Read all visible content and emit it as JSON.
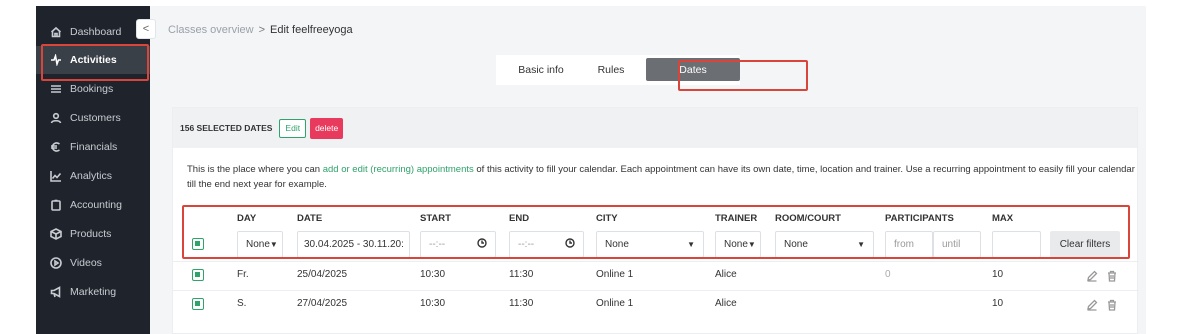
{
  "sidebar": {
    "items": [
      {
        "label": "Dashboard",
        "icon": "home-icon"
      },
      {
        "label": "Activities",
        "icon": "activity-icon",
        "active": true
      },
      {
        "label": "Bookings",
        "icon": "list-icon"
      },
      {
        "label": "Customers",
        "icon": "user-icon"
      },
      {
        "label": "Financials",
        "icon": "euro-icon"
      },
      {
        "label": "Analytics",
        "icon": "chart-icon"
      },
      {
        "label": "Accounting",
        "icon": "clipboard-icon"
      },
      {
        "label": "Products",
        "icon": "box-icon"
      },
      {
        "label": "Videos",
        "icon": "play-icon"
      },
      {
        "label": "Marketing",
        "icon": "megaphone-icon"
      }
    ]
  },
  "header": {
    "back": "<",
    "breadcrumb": {
      "parent": "Classes overview",
      "separator": ">",
      "current": "Edit feelfreeyoga"
    }
  },
  "tabs": [
    {
      "label": "Basic info"
    },
    {
      "label": "Rules"
    },
    {
      "label": "Dates",
      "active": true
    }
  ],
  "card": {
    "selected_count": "156 SELECTED DATES",
    "edit_label": "Edit",
    "delete_label": "delete",
    "info_before": "This is the place where you can ",
    "info_link": "add or edit (recurring) appointments",
    "info_after": " of this activity to fill your calendar. Each appointment can have its own date, time, location and trainer. Use a recurring appointment to easily fill your calendar till the end next year for example."
  },
  "table": {
    "headers": {
      "day": "DAY",
      "date": "DATE",
      "start": "START",
      "end": "END",
      "city": "CITY",
      "trainer": "TRAINER",
      "room": "ROOM/COURT",
      "participants": "PARTICIPANTS",
      "max": "MAX"
    },
    "filters": {
      "day": "None",
      "date": "30.04.2025 - 30.11.20:",
      "start": "--:--",
      "end": "--:--",
      "city": "None",
      "trainer": "None",
      "room": "None",
      "participants_from": "from",
      "participants_until": "until",
      "max": "",
      "clear_label": "Clear filters"
    },
    "rows": [
      {
        "day": "Fr.",
        "date": "25/04/2025",
        "start": "10:30",
        "end": "11:30",
        "city": "Online 1",
        "trainer": "Alice",
        "room": "",
        "participants": "0",
        "max": "10"
      },
      {
        "day": "S.",
        "date": "27/04/2025",
        "start": "10:30",
        "end": "11:30",
        "city": "Online 1",
        "trainer": "Alice",
        "room": "",
        "participants": "",
        "max": "10"
      }
    ]
  },
  "colors": {
    "accent_green": "#2fa36a",
    "danger": "#e83a5c",
    "highlight": "#d9453b",
    "sidebar_bg": "#1f242c"
  }
}
